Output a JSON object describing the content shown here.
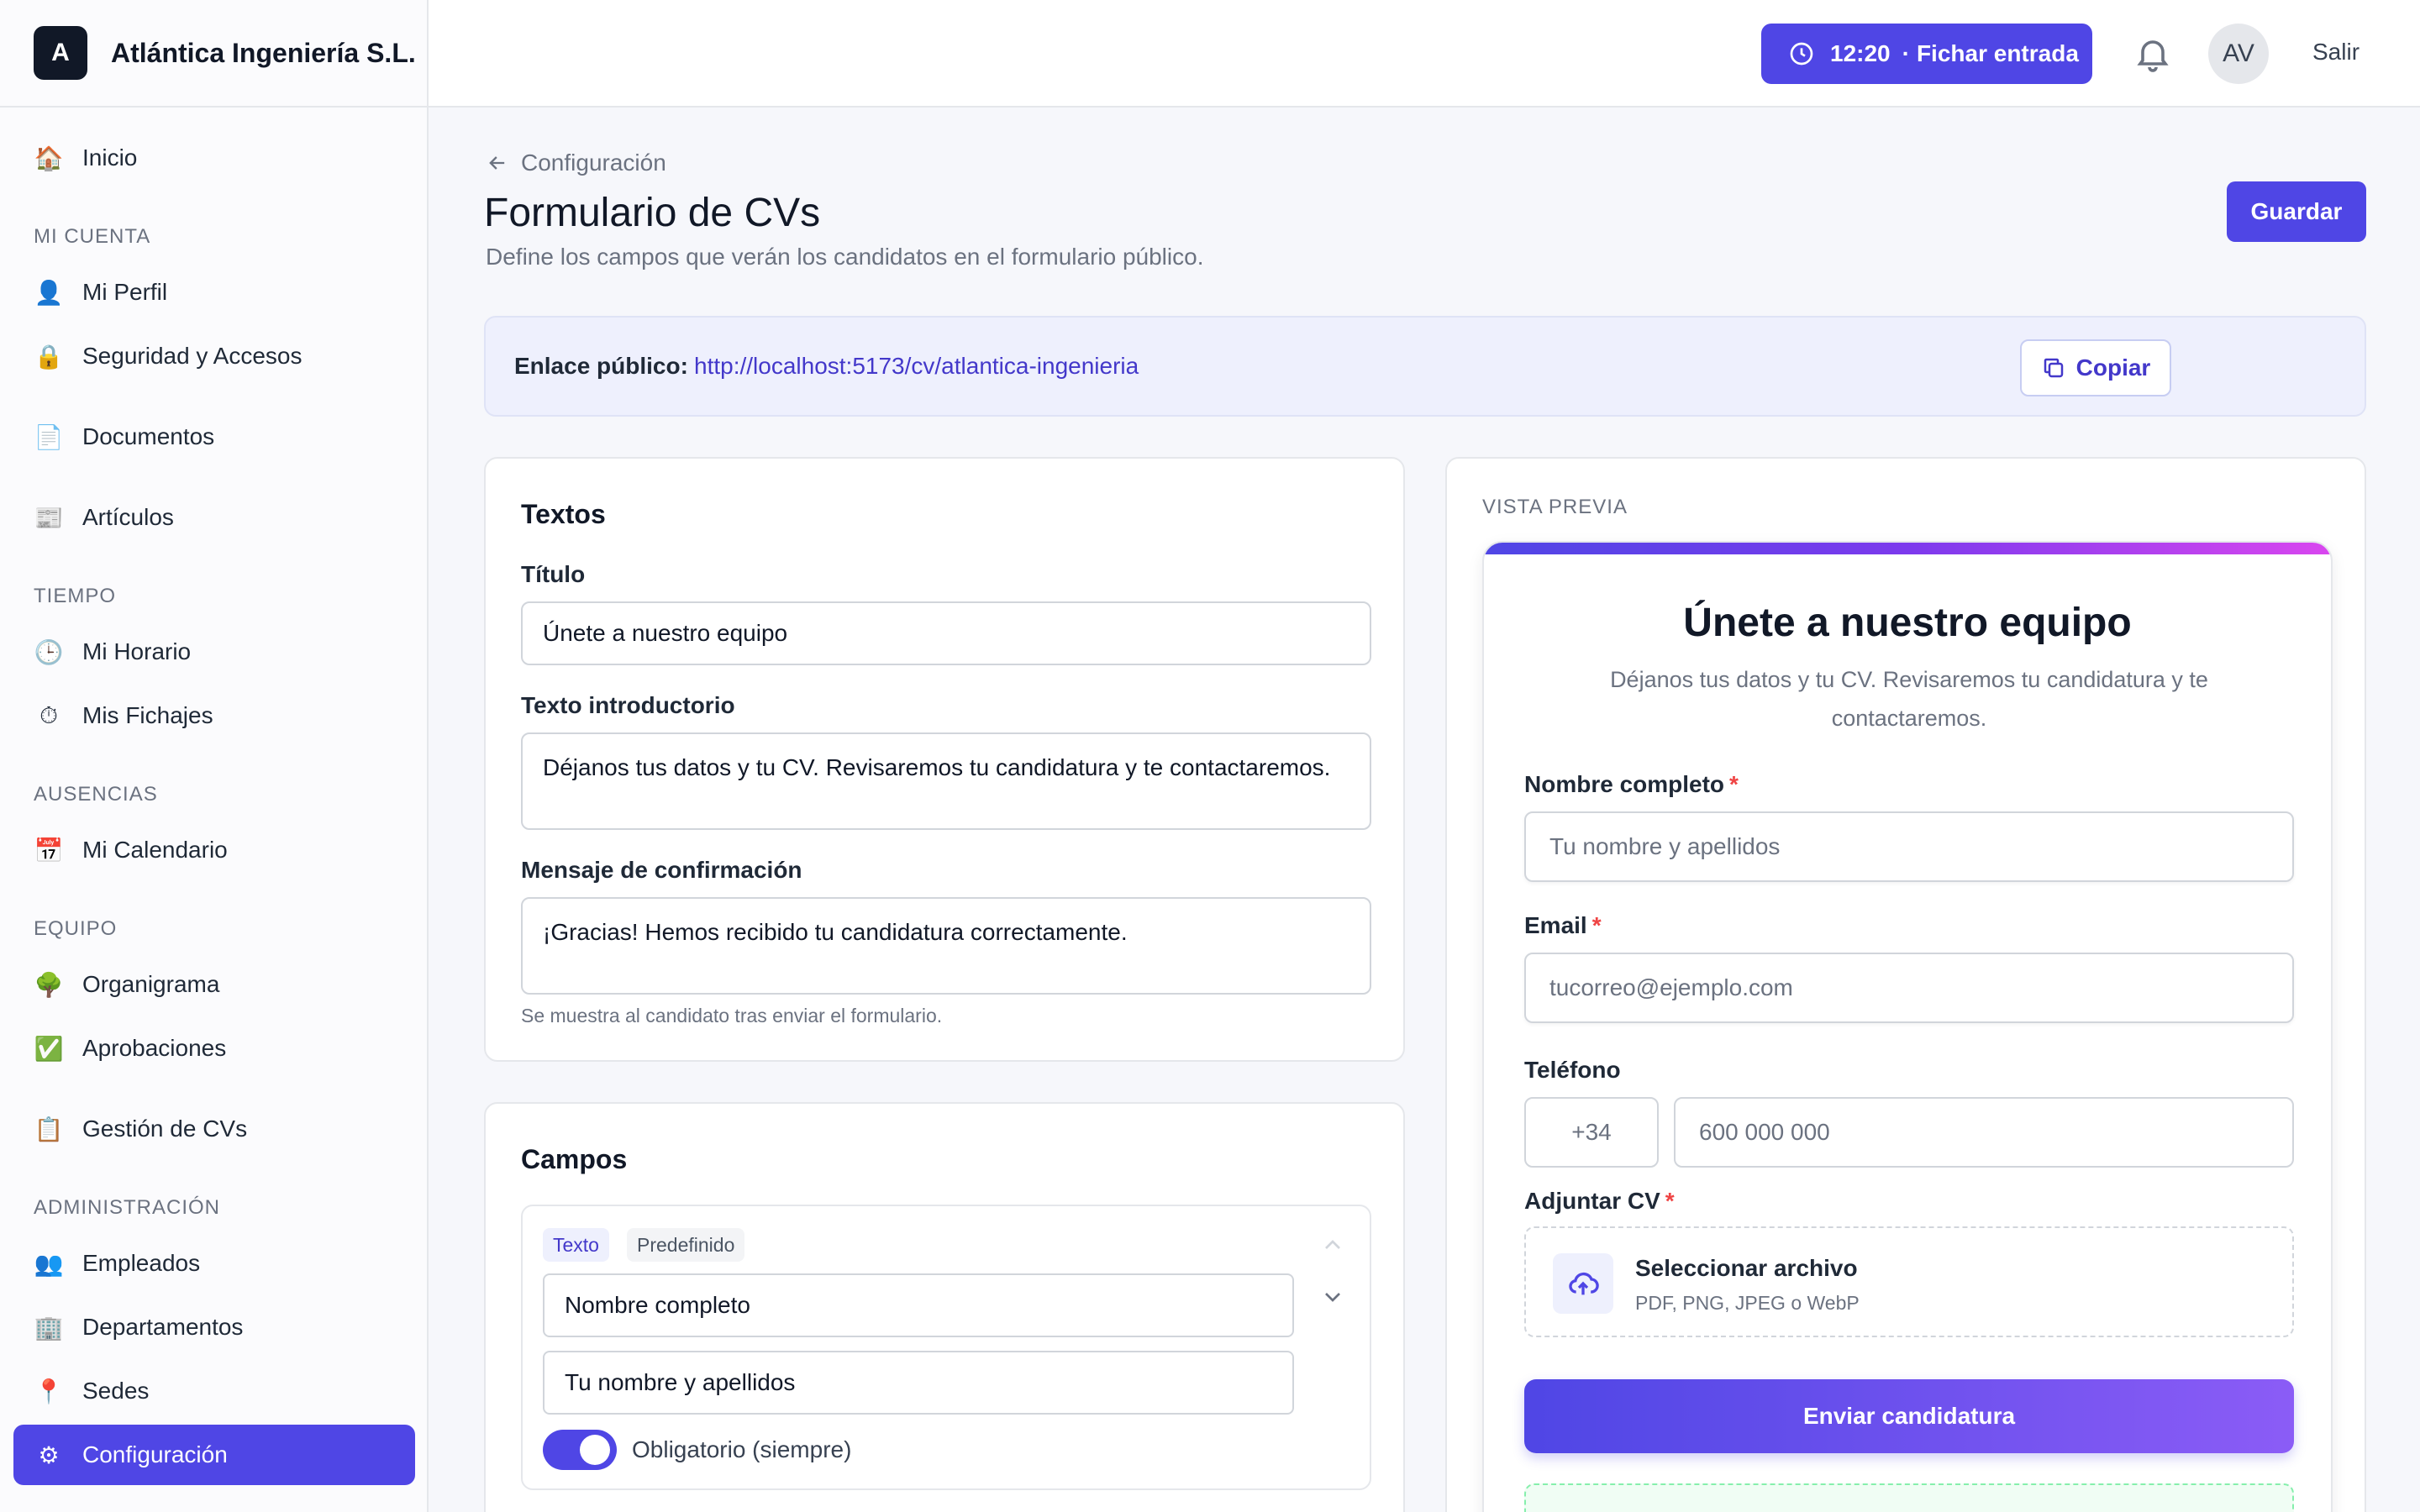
{
  "company": {
    "initial": "A",
    "name": "Atlántica Ingeniería S.L."
  },
  "topbar": {
    "time": "12:20",
    "clock_action": "Fichar entrada",
    "avatar_initials": "AV",
    "logout": "Salir"
  },
  "sidebar": {
    "home": "Inicio",
    "section_account": "MI CUENTA",
    "profile": "Mi Perfil",
    "security": "Seguridad y Accesos",
    "documents": "Documentos",
    "articles": "Artículos",
    "section_time": "TIEMPO",
    "schedule": "Mi Horario",
    "clockings": "Mis Fichajes",
    "section_absences": "AUSENCIAS",
    "calendar": "Mi Calendario",
    "section_team": "EQUIPO",
    "orgchart": "Organigrama",
    "approvals": "Aprobaciones",
    "cv_management": "Gestión de CVs",
    "section_admin": "ADMINISTRACIÓN",
    "employees": "Empleados",
    "departments": "Departamentos",
    "sites": "Sedes",
    "settings": "Configuración"
  },
  "header": {
    "breadcrumb": "Configuración",
    "title": "Formulario de CVs",
    "description": "Define los campos que verán los candidatos en el formulario público.",
    "save": "Guardar"
  },
  "public_link": {
    "label": "Enlace público:",
    "url": "http://localhost:5173/cv/atlantica-ingenieria",
    "copy": "Copiar"
  },
  "texts": {
    "title": "Textos",
    "title_label": "Título",
    "title_value": "Únete a nuestro equipo",
    "intro_label": "Texto introductorio",
    "intro_value": "Déjanos tus datos y tu CV. Revisaremos tu candidatura y te contactaremos.",
    "confirm_label": "Mensaje de confirmación",
    "confirm_value": "¡Gracias! Hemos recibido tu candidatura correctamente.",
    "confirm_hint": "Se muestra al candidato tras enviar el formulario."
  },
  "fields": {
    "title": "Campos",
    "item": {
      "type": "Texto",
      "badge": "Predefinido",
      "label_value": "Nombre completo",
      "placeholder_value": "Tu nombre y apellidos",
      "required_label": "Obligatorio (siempre)",
      "required": true
    }
  },
  "preview": {
    "section_label": "VISTA PREVIA",
    "title": "Únete a nuestro equipo",
    "intro": "Déjanos tus datos y tu CV. Revisaremos tu candidatura y te contactaremos.",
    "name_label": "Nombre completo",
    "name_placeholder": "Tu nombre y apellidos",
    "email_label": "Email",
    "email_placeholder": "tucorreo@ejemplo.com",
    "phone_label": "Teléfono",
    "phone_prefix": "+34",
    "phone_placeholder": "600 000 000",
    "cv_label": "Adjuntar CV",
    "upload_title": "Seleccionar archivo",
    "upload_formats": "PDF, PNG, JPEG o WebP",
    "submit": "Enviar candidatura",
    "required_mark": "*"
  },
  "colors": {
    "accent": "#4f46e5",
    "accent_text": "#4338ca",
    "required": "#ef4444",
    "gradient_end": "#d946ef"
  },
  "icons": {
    "home": "house-icon",
    "profile": "person-icon",
    "security": "lock-icon",
    "documents": "document-icon",
    "articles": "newspaper-icon",
    "schedule": "clock-icon",
    "clockings": "stopwatch-icon",
    "calendar": "calendar-icon",
    "orgchart": "tree-icon",
    "approvals": "checkbox-icon",
    "cv_management": "clipboard-icon",
    "employees": "people-icon",
    "departments": "building-icon",
    "sites": "pin-icon",
    "settings": "gear-icon"
  }
}
